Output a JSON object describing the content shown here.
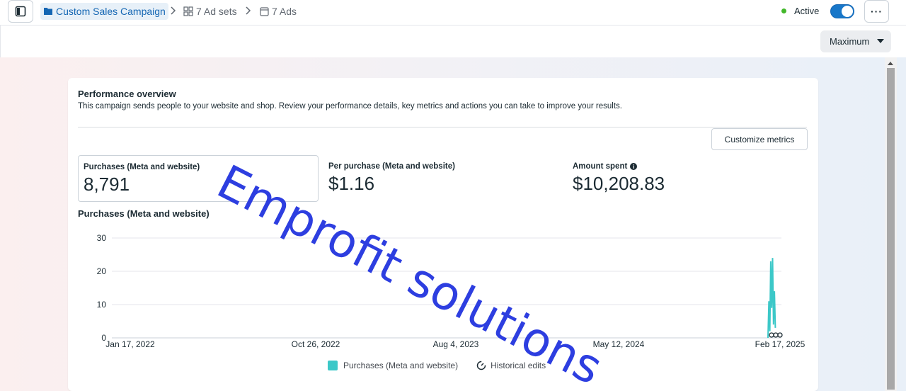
{
  "header": {
    "campaign_name": "Custom Sales Campaign",
    "ad_sets": "7 Ad sets",
    "ads": "7 Ads",
    "status": "Active",
    "more_label": "···"
  },
  "toolbar": {
    "timeframe": "Maximum"
  },
  "overview": {
    "title": "Performance overview",
    "subtitle": "This campaign sends people to your website and shop. Review your performance details, key metrics and actions you can take to improve your results.",
    "customize_label": "Customize metrics",
    "metrics": [
      {
        "label": "Purchases (Meta and website)",
        "value": "8,791"
      },
      {
        "label": "Per purchase (Meta and website)",
        "value": "$1.16"
      },
      {
        "label": "Amount spent",
        "value": "$10,208.83"
      }
    ]
  },
  "chart_section_title": "Purchases (Meta and website)",
  "chart_data": {
    "type": "line",
    "title": "Purchases (Meta and website)",
    "x_tick_labels": [
      "Jan 17, 2022",
      "Oct 26, 2022",
      "Aug 4, 2023",
      "May 12, 2024",
      "Feb 17, 2025"
    ],
    "y_ticks": [
      0,
      10,
      20,
      30
    ],
    "ylim": [
      0,
      30
    ],
    "grid": true,
    "legend_position": "bottom",
    "series": [
      {
        "name": "Purchases (Meta and website)",
        "color": "#3cc8c8",
        "points": [
          {
            "x": "2025-02-01",
            "y": 0
          },
          {
            "x": "2025-02-02",
            "y": 11
          },
          {
            "x": "2025-02-03",
            "y": 2
          },
          {
            "x": "2025-02-04",
            "y": 23
          },
          {
            "x": "2025-02-05",
            "y": 9
          },
          {
            "x": "2025-02-06",
            "y": 24
          },
          {
            "x": "2025-02-07",
            "y": 4
          },
          {
            "x": "2025-02-08",
            "y": 14
          },
          {
            "x": "2025-02-09",
            "y": 3
          }
        ]
      }
    ],
    "legend": [
      "Purchases (Meta and website)",
      "Historical edits"
    ]
  },
  "watermark": "Emprofit solutions",
  "colors": {
    "accent": "#1877c9",
    "series": "#3cc8c8",
    "active_dot": "#42b72a"
  },
  "icons": [
    "sidebar-panel-icon",
    "folder-icon",
    "grid-icon",
    "ad-icon",
    "chevron-right-icon",
    "info-icon",
    "gauge-icon"
  ]
}
